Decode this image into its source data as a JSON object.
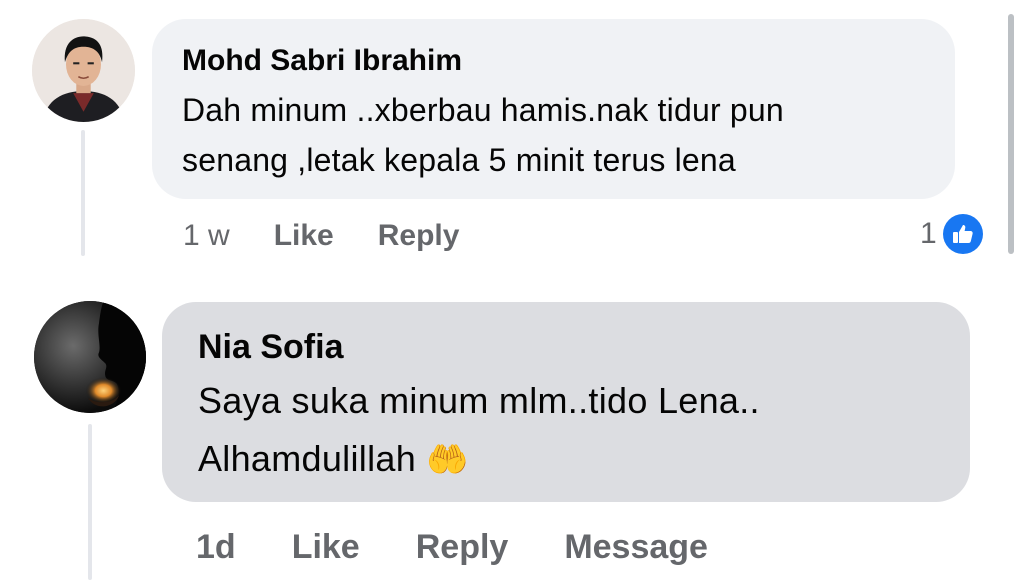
{
  "comments": [
    {
      "author": "Mohd Sabri Ibrahim",
      "text_line1": "Dah minum ..xberbau hamis.nak tidur pun",
      "text_line2": "senang ,letak kepala 5 minit terus lena",
      "time": "1 w",
      "like_label": "Like",
      "reply_label": "Reply",
      "reaction_count": "1",
      "reaction_icon": "thumbs-up-icon"
    },
    {
      "author": "Nia Sofia",
      "text_line1": "Saya suka minum mlm..tido Lena..",
      "text_line2": "Alhamdulillah",
      "emoji": "🤲",
      "time": "1d",
      "like_label": "Like",
      "reply_label": "Reply",
      "message_label": "Message"
    }
  ],
  "colors": {
    "like_blue": "#1877f2",
    "bubble_light": "#f0f2f5",
    "bubble_grey": "#dcdde1",
    "meta_grey": "#65676b"
  }
}
